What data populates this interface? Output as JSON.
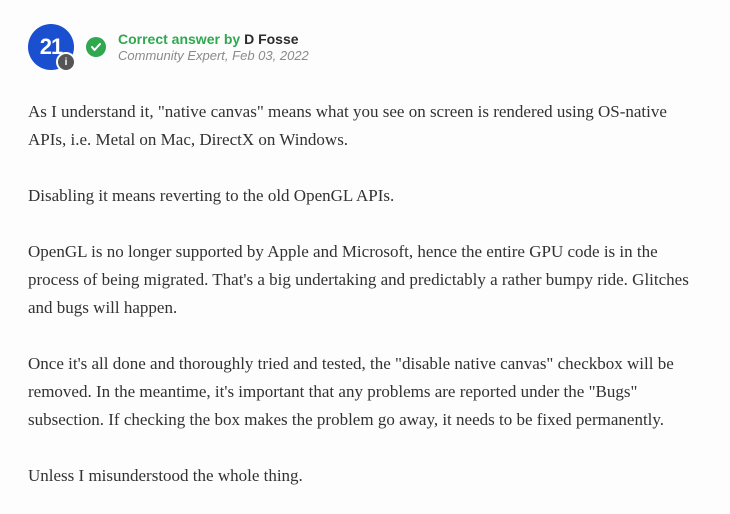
{
  "header": {
    "avatar_text": "21",
    "avatar_corner": "i",
    "correct_prefix": "Correct answer by ",
    "author": "D Fosse",
    "role": "Community Expert",
    "date": "Feb 03, 2022"
  },
  "body": {
    "p1": "As I understand it, \"native canvas\" means what you see on screen is rendered using OS-native APIs, i.e. Metal on Mac, DirectX on Windows.",
    "p2": "Disabling it means reverting to the old OpenGL APIs.",
    "p3": "OpenGL is no longer supported by Apple and Microsoft, hence the entire GPU code is in the process of being migrated. That's a big undertaking and predictably a rather bumpy ride. Glitches and bugs will happen.",
    "p4": "Once it's all done and thoroughly tried and tested, the \"disable native canvas\" checkbox will be removed. In the meantime, it's important that any problems are reported under the \"Bugs\" subsection. If checking the box makes the problem go away, it needs to be fixed permanently.",
    "p5": "Unless I misunderstood the whole thing."
  }
}
